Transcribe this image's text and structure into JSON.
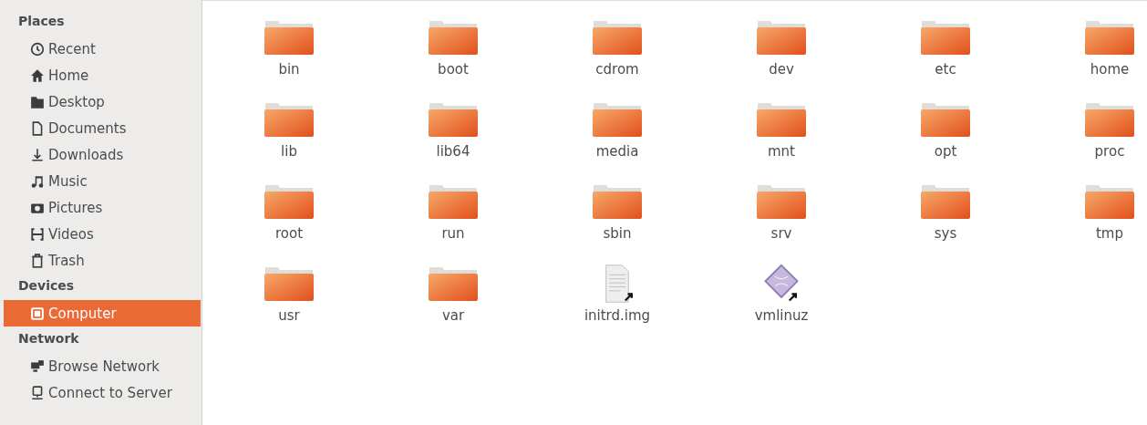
{
  "sidebar": {
    "sections": [
      {
        "title": "Places",
        "items": [
          {
            "label": "Recent",
            "kind": "recent",
            "selected": false
          },
          {
            "label": "Home",
            "kind": "home",
            "selected": false
          },
          {
            "label": "Desktop",
            "kind": "desktop",
            "selected": false
          },
          {
            "label": "Documents",
            "kind": "document",
            "selected": false
          },
          {
            "label": "Downloads",
            "kind": "download",
            "selected": false
          },
          {
            "label": "Music",
            "kind": "music",
            "selected": false
          },
          {
            "label": "Pictures",
            "kind": "camera",
            "selected": false
          },
          {
            "label": "Videos",
            "kind": "video",
            "selected": false
          },
          {
            "label": "Trash",
            "kind": "trash",
            "selected": false
          }
        ]
      },
      {
        "title": "Devices",
        "items": [
          {
            "label": "Computer",
            "kind": "computer",
            "selected": true
          }
        ]
      },
      {
        "title": "Network",
        "items": [
          {
            "label": "Browse Network",
            "kind": "network",
            "selected": false
          },
          {
            "label": "Connect to Server",
            "kind": "server",
            "selected": false
          }
        ]
      }
    ]
  },
  "files": [
    {
      "name": "bin",
      "kind": "folder",
      "symlink": false
    },
    {
      "name": "boot",
      "kind": "folder",
      "symlink": false
    },
    {
      "name": "cdrom",
      "kind": "folder",
      "symlink": false
    },
    {
      "name": "dev",
      "kind": "folder",
      "symlink": false
    },
    {
      "name": "etc",
      "kind": "folder",
      "symlink": false
    },
    {
      "name": "home",
      "kind": "folder",
      "symlink": false
    },
    {
      "name": "lib",
      "kind": "folder",
      "symlink": false
    },
    {
      "name": "lib64",
      "kind": "folder",
      "symlink": false
    },
    {
      "name": "media",
      "kind": "folder",
      "symlink": false
    },
    {
      "name": "mnt",
      "kind": "folder",
      "symlink": false
    },
    {
      "name": "opt",
      "kind": "folder",
      "symlink": false
    },
    {
      "name": "proc",
      "kind": "folder",
      "symlink": false
    },
    {
      "name": "root",
      "kind": "folder",
      "symlink": false
    },
    {
      "name": "run",
      "kind": "folder",
      "symlink": false
    },
    {
      "name": "sbin",
      "kind": "folder",
      "symlink": false
    },
    {
      "name": "srv",
      "kind": "folder",
      "symlink": false
    },
    {
      "name": "sys",
      "kind": "folder",
      "symlink": false
    },
    {
      "name": "tmp",
      "kind": "folder",
      "symlink": false
    },
    {
      "name": "usr",
      "kind": "folder",
      "symlink": false
    },
    {
      "name": "var",
      "kind": "folder",
      "symlink": false
    },
    {
      "name": "initrd.img",
      "kind": "document",
      "symlink": true
    },
    {
      "name": "vmlinuz",
      "kind": "executable",
      "symlink": true
    }
  ]
}
